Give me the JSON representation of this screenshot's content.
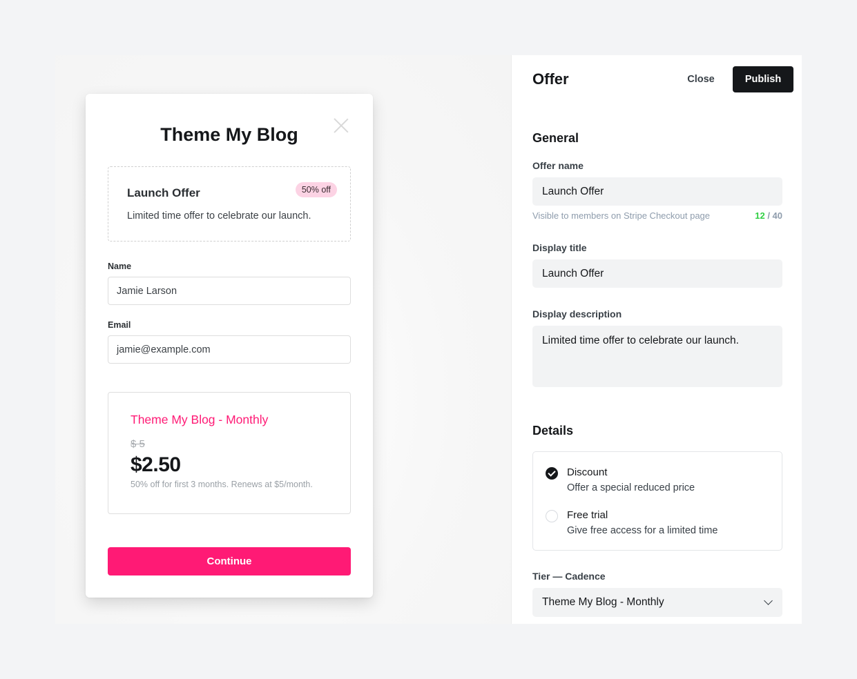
{
  "preview": {
    "site_title": "Theme My Blog",
    "offer": {
      "title": "Launch Offer",
      "badge": "50% off",
      "description": "Limited time offer to celebrate our launch."
    },
    "form": {
      "name_label": "Name",
      "name_value": "Jamie Larson",
      "email_label": "Email",
      "email_value": "jamie@example.com"
    },
    "plan": {
      "name": "Theme My Blog - Monthly",
      "original_price": "$ 5",
      "price": "$2.50",
      "note": "50% off for first 3 months. Renews at $5/month."
    },
    "continue_label": "Continue"
  },
  "panel": {
    "title": "Offer",
    "close_label": "Close",
    "publish_label": "Publish",
    "general": {
      "heading": "General",
      "offer_name_label": "Offer name",
      "offer_name_value": "Launch Offer",
      "offer_name_hint": "Visible to members on Stripe Checkout page",
      "char_count": "12",
      "char_limit": " / 40",
      "display_title_label": "Display title",
      "display_title_value": "Launch Offer",
      "display_description_label": "Display description",
      "display_description_value": "Limited time offer to celebrate our launch."
    },
    "details": {
      "heading": "Details",
      "options": [
        {
          "title": "Discount",
          "description": "Offer a special reduced price",
          "selected": true
        },
        {
          "title": "Free trial",
          "description": "Give free access for a limited time",
          "selected": false
        }
      ],
      "tier_label": "Tier — Cadence",
      "tier_value": "Theme My Blog - Monthly"
    }
  },
  "colors": {
    "accent": "#ff1a75",
    "badge_bg": "#fcd3e4",
    "count_ok": "#30cf43",
    "dark": "#15171a"
  }
}
